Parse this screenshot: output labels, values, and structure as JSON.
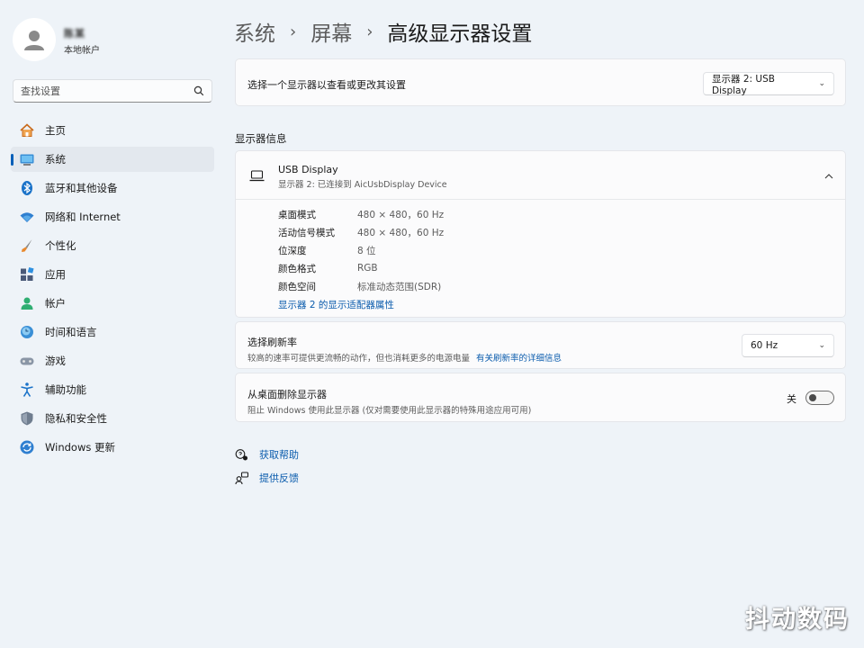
{
  "profile": {
    "name": "陈某",
    "account_type": "本地帐户"
  },
  "search": {
    "placeholder": "查找设置"
  },
  "sidebar": {
    "items": [
      {
        "label": "主页",
        "icon": "home-icon"
      },
      {
        "label": "系统",
        "icon": "system-icon",
        "active": true
      },
      {
        "label": "蓝牙和其他设备",
        "icon": "bluetooth-icon"
      },
      {
        "label": "网络和 Internet",
        "icon": "wifi-icon"
      },
      {
        "label": "个性化",
        "icon": "brush-icon"
      },
      {
        "label": "应用",
        "icon": "apps-icon"
      },
      {
        "label": "帐户",
        "icon": "account-icon"
      },
      {
        "label": "时间和语言",
        "icon": "time-language-icon"
      },
      {
        "label": "游戏",
        "icon": "gaming-icon"
      },
      {
        "label": "辅助功能",
        "icon": "accessibility-icon"
      },
      {
        "label": "隐私和安全性",
        "icon": "shield-icon"
      },
      {
        "label": "Windows 更新",
        "icon": "update-icon"
      }
    ]
  },
  "breadcrumb": {
    "items": [
      "系统",
      "屏幕",
      "高级显示器设置"
    ],
    "separator": "›"
  },
  "display_select": {
    "label": "选择一个显示器以查看或更改其设置",
    "value": "显示器 2: USB Display"
  },
  "display_info": {
    "section_title": "显示器信息",
    "name": "USB Display",
    "subtitle": "显示器 2: 已连接到 AicUsbDisplay Device",
    "rows": [
      {
        "key": "桌面模式",
        "value": "480 × 480，60 Hz"
      },
      {
        "key": "活动信号模式",
        "value": "480 × 480，60 Hz"
      },
      {
        "key": "位深度",
        "value": "8 位"
      },
      {
        "key": "颜色格式",
        "value": "RGB"
      },
      {
        "key": "颜色空间",
        "value": "标准动态范围(SDR)"
      }
    ],
    "adapter_link": "显示器 2 的显示适配器属性"
  },
  "refresh_rate": {
    "title": "选择刷新率",
    "description": "较高的速率可提供更流畅的动作，但也消耗更多的电源电量",
    "link": "有关刷新率的详细信息",
    "value": "60 Hz"
  },
  "remove_display": {
    "title": "从桌面删除显示器",
    "description": "阻止 Windows 使用此显示器 (仅对需要使用此显示器的特殊用途应用可用)",
    "toggle_label": "关",
    "toggle_on": false
  },
  "help": {
    "get_help": "获取帮助",
    "feedback": "提供反馈"
  },
  "watermark": "抖动数码",
  "colors": {
    "accent": "#005fb8",
    "link": "#0b5cad",
    "background": "#eef3f8",
    "card": "#fbfbfc"
  }
}
